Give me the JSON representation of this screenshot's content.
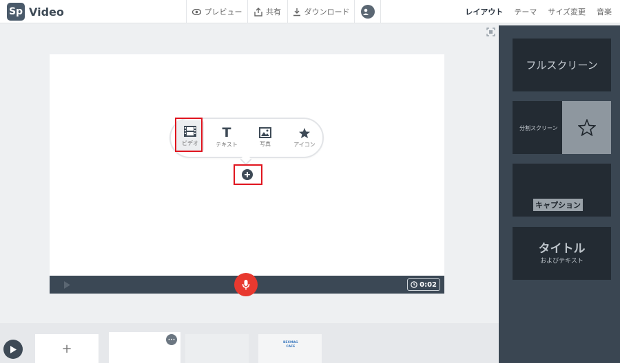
{
  "app": {
    "logo_badge": "Sp",
    "logo_text": "Video"
  },
  "toolbar": {
    "preview": "プレビュー",
    "share": "共有",
    "download": "ダウンロード"
  },
  "tabs": [
    "レイアウト",
    "テーマ",
    "サイズ変更",
    "音楽"
  ],
  "active_tab": "レイアウト",
  "insert_menu": {
    "items": [
      "ビデオ",
      "テキスト",
      "写真",
      "アイコン"
    ],
    "text_glyph": "T"
  },
  "player": {
    "time": "0:02"
  },
  "layouts": {
    "fullscreen": "フルスクリーン",
    "split": "分割スクリーン",
    "caption": "キャプション",
    "title_big": "タイトル",
    "title_small": "およびテキスト"
  },
  "filmstrip": {
    "add": "+",
    "more": "•••",
    "cafe_brand": "BEXMAG",
    "cafe_name": "CAFE"
  },
  "colors": {
    "accent_red": "#e8392f",
    "highlight": "#e0141e",
    "panel": "#3a4652"
  }
}
